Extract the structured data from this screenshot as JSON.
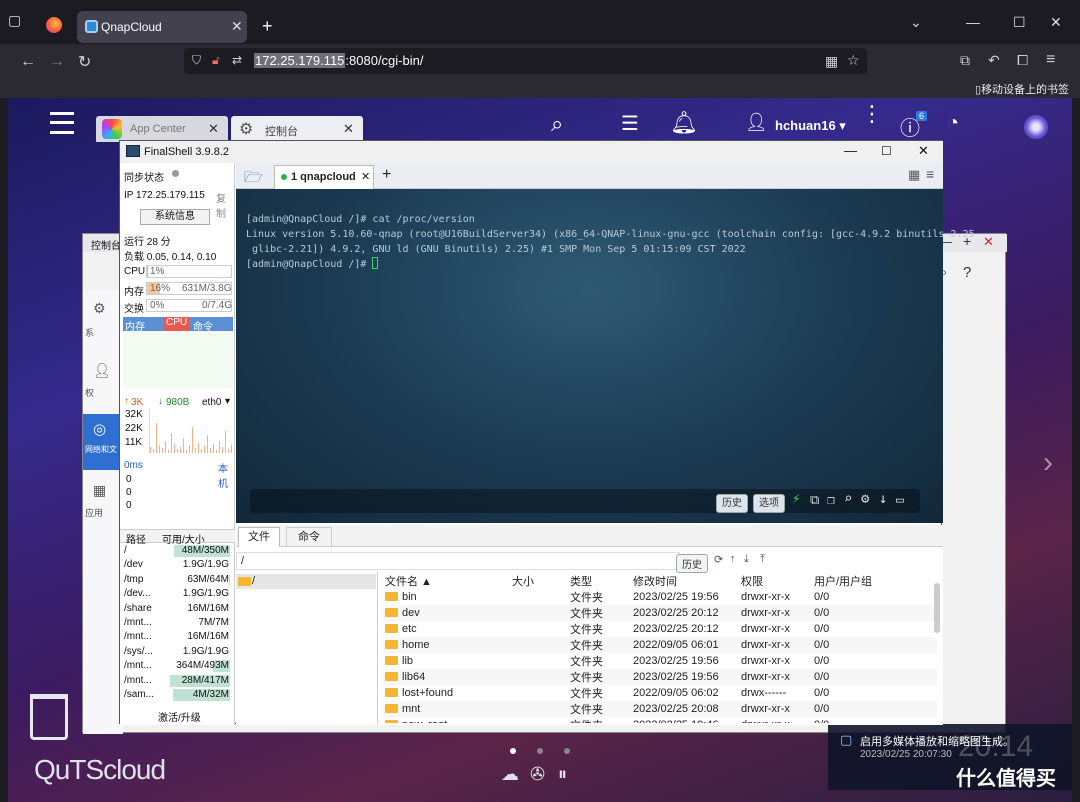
{
  "browser": {
    "tab_title": "QnapCloud",
    "url_host": "172.25.179.115",
    "url_rest": ":8080/cgi-bin/",
    "bookmarks_label": "移动设备上的书签"
  },
  "qnap": {
    "app_center": "App Center",
    "control_panel": "控制台",
    "username": "hchuan16",
    "badge_count": "6",
    "bg_window_title": "控制台",
    "bg_side": [
      "系",
      "权",
      "网络和文",
      "应用"
    ],
    "logo": "QuTScloud",
    "notification_text": "启用多媒体播放和缩略图生成。",
    "notification_time": "2023/02/25 20:07:30",
    "clock": "20:14",
    "watermark": "什么值得买"
  },
  "finalshell": {
    "title": "FinalShell 3.9.8.2",
    "sync_label": "同步状态",
    "ip_label": "IP",
    "ip_value": "172.25.179.115",
    "copy_label": "复制",
    "sysinfo_button": "系统信息",
    "uptime": "运行 28 分",
    "load": "负载 0.05, 0.14, 0.10",
    "cpu_label": "CPU",
    "cpu_value": "1%",
    "mem_label": "内存",
    "mem_pct": "16%",
    "mem_value": "631M/3.8G",
    "swap_label": "交换",
    "swap_pct": "0%",
    "swap_value": "0/7.4G",
    "proc_tabs": [
      "内存",
      "CPU",
      "命令"
    ],
    "net_up": "3K",
    "net_down": "980B",
    "net_iface": "eth0",
    "net_scale": [
      "32K",
      "22K",
      "11K"
    ],
    "latency": "0ms",
    "latency_host": "本机",
    "latency_vals": [
      "0",
      "0",
      "0"
    ],
    "disk_headers": [
      "路径",
      "可用/大小"
    ],
    "disks": [
      {
        "path": "/",
        "size": "48M/350M",
        "used": 0.86
      },
      {
        "path": "/dev",
        "size": "1.9G/1.9G",
        "used": 0.0
      },
      {
        "path": "/tmp",
        "size": "63M/64M",
        "used": 0.02
      },
      {
        "path": "/dev...",
        "size": "1.9G/1.9G",
        "used": 0.0
      },
      {
        "path": "/share",
        "size": "16M/16M",
        "used": 0.0
      },
      {
        "path": "/mnt...",
        "size": "7M/7M",
        "used": 0.0
      },
      {
        "path": "/mnt...",
        "size": "16M/16M",
        "used": 0.0
      },
      {
        "path": "/sys/...",
        "size": "1.9G/1.9G",
        "used": 0.0
      },
      {
        "path": "/mnt...",
        "size": "364M/493M",
        "used": 0.26
      },
      {
        "path": "/mnt...",
        "size": "28M/417M",
        "used": 0.93
      },
      {
        "path": "/sam...",
        "size": "4M/32M",
        "used": 0.88
      }
    ],
    "activate": "激活/升级",
    "session_tab": "1 qnapcloud",
    "terminal_lines": [
      "[admin@QnapCloud /]# cat /proc/version",
      "Linux version 5.10.60-qnap (root@U16BuildServer34) (x86_64-QNAP-linux-gnu-gcc (toolchain config: [gcc-4.9.2 binutils-2.25",
      " glibc-2.21]) 4.9.2, GNU ld (GNU Binutils) 2.25) #1 SMP Mon Sep 5 01:15:09 CST 2022",
      "[admin@QnapCloud /]# "
    ],
    "history_btn": "历史",
    "options_btn": "选项",
    "file_tabs": [
      "文件",
      "命令"
    ],
    "current_path": "/",
    "history_btn2": "历史",
    "tree_root": "/",
    "file_headers": [
      "文件名 ▲",
      "大小",
      "类型",
      "修改时间",
      "权限",
      "用户/用户组"
    ],
    "files": [
      {
        "name": "bin",
        "size": "",
        "type": "文件夹",
        "mtime": "2023/02/25 19:56",
        "perm": "drwxr-xr-x",
        "owner": "0/0"
      },
      {
        "name": "dev",
        "size": "",
        "type": "文件夹",
        "mtime": "2023/02/25 20:12",
        "perm": "drwxr-xr-x",
        "owner": "0/0"
      },
      {
        "name": "etc",
        "size": "",
        "type": "文件夹",
        "mtime": "2023/02/25 20:12",
        "perm": "drwxr-xr-x",
        "owner": "0/0"
      },
      {
        "name": "home",
        "size": "",
        "type": "文件夹",
        "mtime": "2022/09/05 06:01",
        "perm": "drwxr-xr-x",
        "owner": "0/0"
      },
      {
        "name": "lib",
        "size": "",
        "type": "文件夹",
        "mtime": "2023/02/25 19:56",
        "perm": "drwxr-xr-x",
        "owner": "0/0"
      },
      {
        "name": "lib64",
        "size": "",
        "type": "文件夹",
        "mtime": "2023/02/25 19:56",
        "perm": "drwxr-xr-x",
        "owner": "0/0"
      },
      {
        "name": "lost+found",
        "size": "",
        "type": "文件夹",
        "mtime": "2022/09/05 06:02",
        "perm": "drwx------",
        "owner": "0/0"
      },
      {
        "name": "mnt",
        "size": "",
        "type": "文件夹",
        "mtime": "2023/02/25 20:08",
        "perm": "drwxr-xr-x",
        "owner": "0/0"
      },
      {
        "name": "new_root",
        "size": "",
        "type": "文件夹",
        "mtime": "2023/02/25 19:46",
        "perm": "drwxr-xr-x",
        "owner": "0/0"
      }
    ]
  }
}
